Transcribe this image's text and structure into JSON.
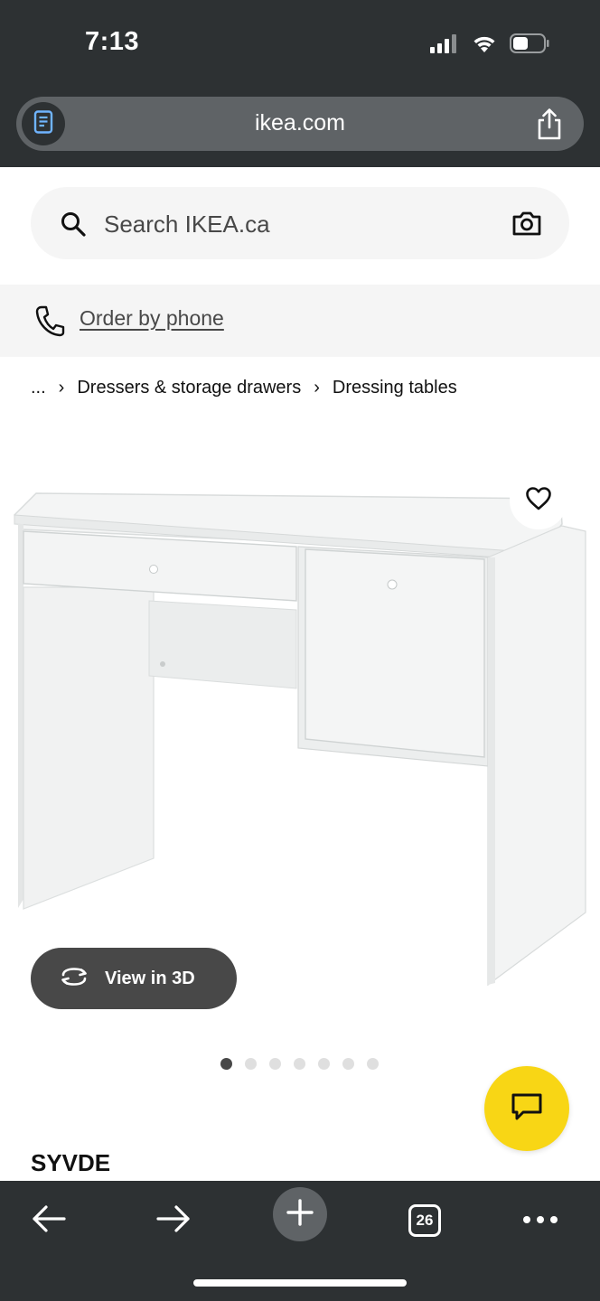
{
  "status_bar": {
    "time": "7:13"
  },
  "browser": {
    "url": "ikea.com"
  },
  "search": {
    "placeholder": "Search IKEA.ca"
  },
  "order_by_phone": {
    "label": "Order by phone"
  },
  "breadcrumb": {
    "ellipsis": "...",
    "items": [
      "Dressers & storage drawers",
      "Dressing tables"
    ]
  },
  "product": {
    "name": "SYVDE",
    "view_3d_label": "View in 3D",
    "image_count": 7,
    "active_image": 1
  },
  "toolbar": {
    "tab_count": "26"
  },
  "colors": {
    "chrome": "#2d3133",
    "chat_fab": "#f8d615",
    "button_dark": "#484848"
  }
}
